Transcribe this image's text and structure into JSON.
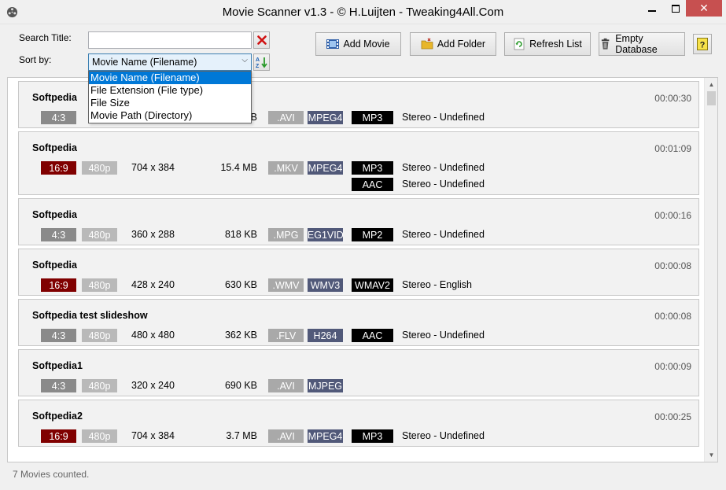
{
  "window": {
    "title": "Movie Scanner v1.3 - © H.Luijten - Tweaking4All.Com",
    "close_glyph": "✕"
  },
  "form": {
    "search_label": "Search Title:",
    "search_value": "",
    "sort_label": "Sort by:",
    "sort_value": "Movie Name (Filename)"
  },
  "toolbar": {
    "add_movie": "Add Movie",
    "add_folder": "Add Folder",
    "refresh_list": "Refresh List",
    "empty_database": "Empty Database"
  },
  "sort_options": [
    "Movie Name (Filename)",
    "File Extension (File type)",
    "File Size",
    "Movie Path (Directory)"
  ],
  "movies": [
    {
      "title": "Softpedia",
      "duration": "00:00:30",
      "aspect": "4:3",
      "res": "",
      "dims": "",
      "size": "1.2 MB",
      "ext": ".AVI",
      "vcodec": "MPEG4",
      "audio": [
        {
          "codec": "MP3",
          "channels": "Stereo - Undefined"
        }
      ]
    },
    {
      "title": "Softpedia",
      "duration": "00:01:09",
      "aspect": "16:9",
      "res": "480p",
      "dims": "704 x 384",
      "size": "15.4 MB",
      "ext": ".MKV",
      "vcodec": "MPEG4",
      "audio": [
        {
          "codec": "MP3",
          "channels": "Stereo - Undefined"
        },
        {
          "codec": "AAC",
          "channels": "Stereo - Undefined"
        }
      ]
    },
    {
      "title": "Softpedia",
      "duration": "00:00:16",
      "aspect": "4:3",
      "res": "480p",
      "dims": "360 x 288",
      "size": "818 KB",
      "ext": ".MPG",
      "vcodec": "MPEG1VIDEO",
      "audio": [
        {
          "codec": "MP2",
          "channels": "Stereo - Undefined"
        }
      ]
    },
    {
      "title": "Softpedia",
      "duration": "00:00:08",
      "aspect": "16:9",
      "res": "480p",
      "dims": "428 x 240",
      "size": "630 KB",
      "ext": ".WMV",
      "vcodec": "WMV3",
      "audio": [
        {
          "codec": "WMAV2",
          "channels": "Stereo - English"
        }
      ]
    },
    {
      "title": "Softpedia test slideshow",
      "duration": "00:00:08",
      "aspect": "4:3",
      "res": "480p",
      "dims": "480 x 480",
      "size": "362 KB",
      "ext": ".FLV",
      "vcodec": "H264",
      "audio": [
        {
          "codec": "AAC",
          "channels": "Stereo - Undefined"
        }
      ]
    },
    {
      "title": "Softpedia1",
      "duration": "00:00:09",
      "aspect": "4:3",
      "res": "480p",
      "dims": "320 x 240",
      "size": "690 KB",
      "ext": ".AVI",
      "vcodec": "MJPEG",
      "audio": []
    },
    {
      "title": "Softpedia2",
      "duration": "00:00:25",
      "aspect": "16:9",
      "res": "480p",
      "dims": "704 x 384",
      "size": "3.7 MB",
      "ext": ".AVI",
      "vcodec": "MPEG4",
      "audio": [
        {
          "codec": "MP3",
          "channels": "Stereo - Undefined"
        }
      ]
    }
  ],
  "status": {
    "text": "7 Movies counted."
  },
  "colors": {
    "aspect_wide": "#800000",
    "aspect_standard": "#8a8a8a",
    "video_codec": "#515979",
    "audio_codec": "#000000",
    "selection": "#0078d7",
    "close_button": "#c75050"
  }
}
